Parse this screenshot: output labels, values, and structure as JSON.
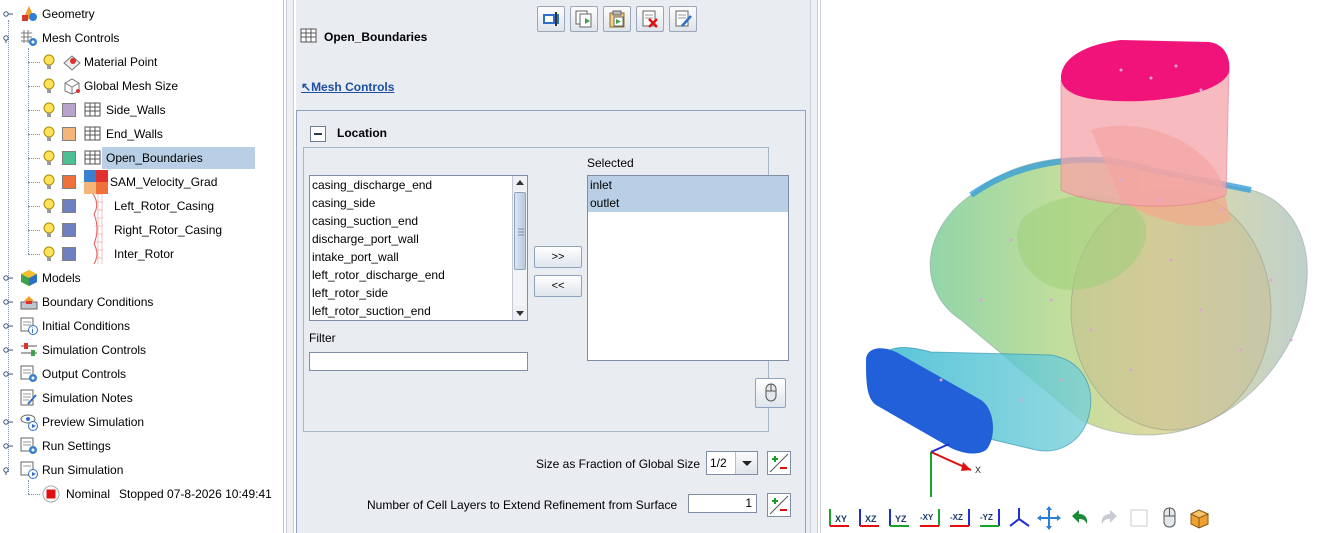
{
  "tree": {
    "items": [
      {
        "label": "Geometry"
      },
      {
        "label": "Mesh Controls"
      },
      {
        "label": "Material Point"
      },
      {
        "label": "Global Mesh Size"
      },
      {
        "label": "Side_Walls",
        "color": "#b7a3cc"
      },
      {
        "label": "End_Walls",
        "color": "#f5b57a"
      },
      {
        "label": "Open_Boundaries",
        "color": "#4cbf95"
      },
      {
        "label": "SAM_Velocity_Grad",
        "color": "#f0703a"
      },
      {
        "label": "Left_Rotor_Casing",
        "color": "#6f7fbf"
      },
      {
        "label": "Right_Rotor_Casing",
        "color": "#6f7fbf"
      },
      {
        "label": "Inter_Rotor",
        "color": "#6f7fbf"
      },
      {
        "label": "Models"
      },
      {
        "label": "Boundary Conditions"
      },
      {
        "label": "Initial Conditions"
      },
      {
        "label": "Simulation Controls"
      },
      {
        "label": "Output Controls"
      },
      {
        "label": "Simulation Notes"
      },
      {
        "label": "Preview Simulation"
      },
      {
        "label": "Run Settings"
      },
      {
        "label": "Run Simulation"
      }
    ],
    "run": {
      "name": "Nominal",
      "status": "Stopped 07-8-2026 10:49:41"
    }
  },
  "panel": {
    "title": "Open_Boundaries",
    "back_link": "Mesh Controls",
    "location": {
      "title": "Location",
      "selected_label": "Selected",
      "available": [
        "casing_discharge_end",
        "casing_side",
        "casing_suction_end",
        "discharge_port_wall",
        "intake_port_wall",
        "left_rotor_discharge_end",
        "left_rotor_side",
        "left_rotor_suction_end"
      ],
      "selected": [
        "inlet",
        "outlet"
      ],
      "add_label": ">>",
      "remove_label": "<<",
      "filter_label": "Filter",
      "filter_value": ""
    },
    "size_fraction_label": "Size as Fraction of Global Size",
    "size_fraction_value": "1/2",
    "cell_layers_label": "Number of Cell Layers to Extend Refinement from Surface",
    "cell_layers_value": "1"
  },
  "view": {
    "axis_x_label": "X",
    "toolbar": {
      "xy": "XY",
      "xz": "XZ",
      "yz": "YZ",
      "nxy": "-XY",
      "nxz": "-XZ",
      "nyz": "-YZ"
    }
  }
}
